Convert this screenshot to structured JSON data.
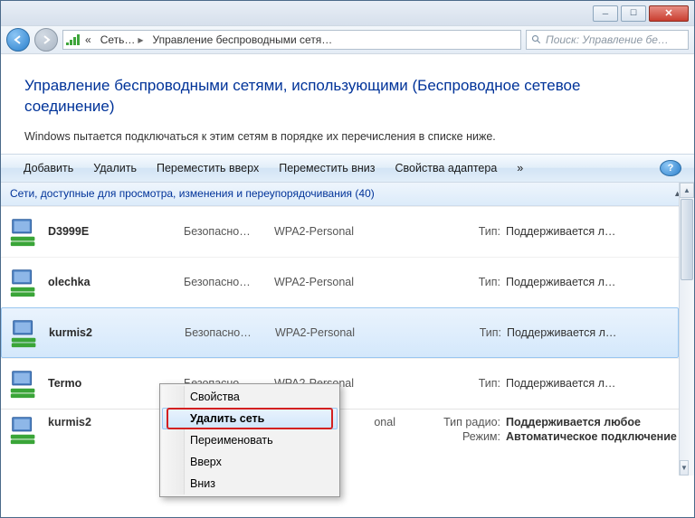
{
  "breadcrumb": {
    "part1": "Сеть…",
    "part2": "Управление беспроводными сетя…",
    "chev": "«"
  },
  "search": {
    "placeholder": "Поиск: Управление бе…"
  },
  "header": {
    "title": "Управление беспроводными сетями, использующими (Беспроводное сетевое соединение)",
    "desc": "Windows пытается подключаться к этим сетям в порядке их перечисления в списке ниже."
  },
  "toolbar": {
    "add": "Добавить",
    "remove": "Удалить",
    "moveup": "Переместить вверх",
    "movedown": "Переместить вниз",
    "adapter": "Свойства адаптера",
    "overflow": "»"
  },
  "category": {
    "label": "Сети, доступные для просмотра, изменения и переупорядочивания (40)"
  },
  "columns": {
    "security": "Безопасно…",
    "encryption": "WPA2-Personal",
    "type": "Тип:",
    "typeval": "Поддерживается л…"
  },
  "rows": [
    {
      "name": "D3999E"
    },
    {
      "name": "olechka"
    },
    {
      "name": "kurmis2"
    },
    {
      "name": "Termo"
    }
  ],
  "bottom": {
    "name": "kurmis2",
    "enc_trunc": "onal",
    "radio_lbl": "Тип радио:",
    "radio_val": "Поддерживается любое",
    "mode_lbl": "Режим:",
    "mode_val": "Автоматическое подключение"
  },
  "context": {
    "properties": "Свойства",
    "delete": "Удалить сеть",
    "rename": "Переименовать",
    "up": "Вверх",
    "down": "Вниз"
  }
}
